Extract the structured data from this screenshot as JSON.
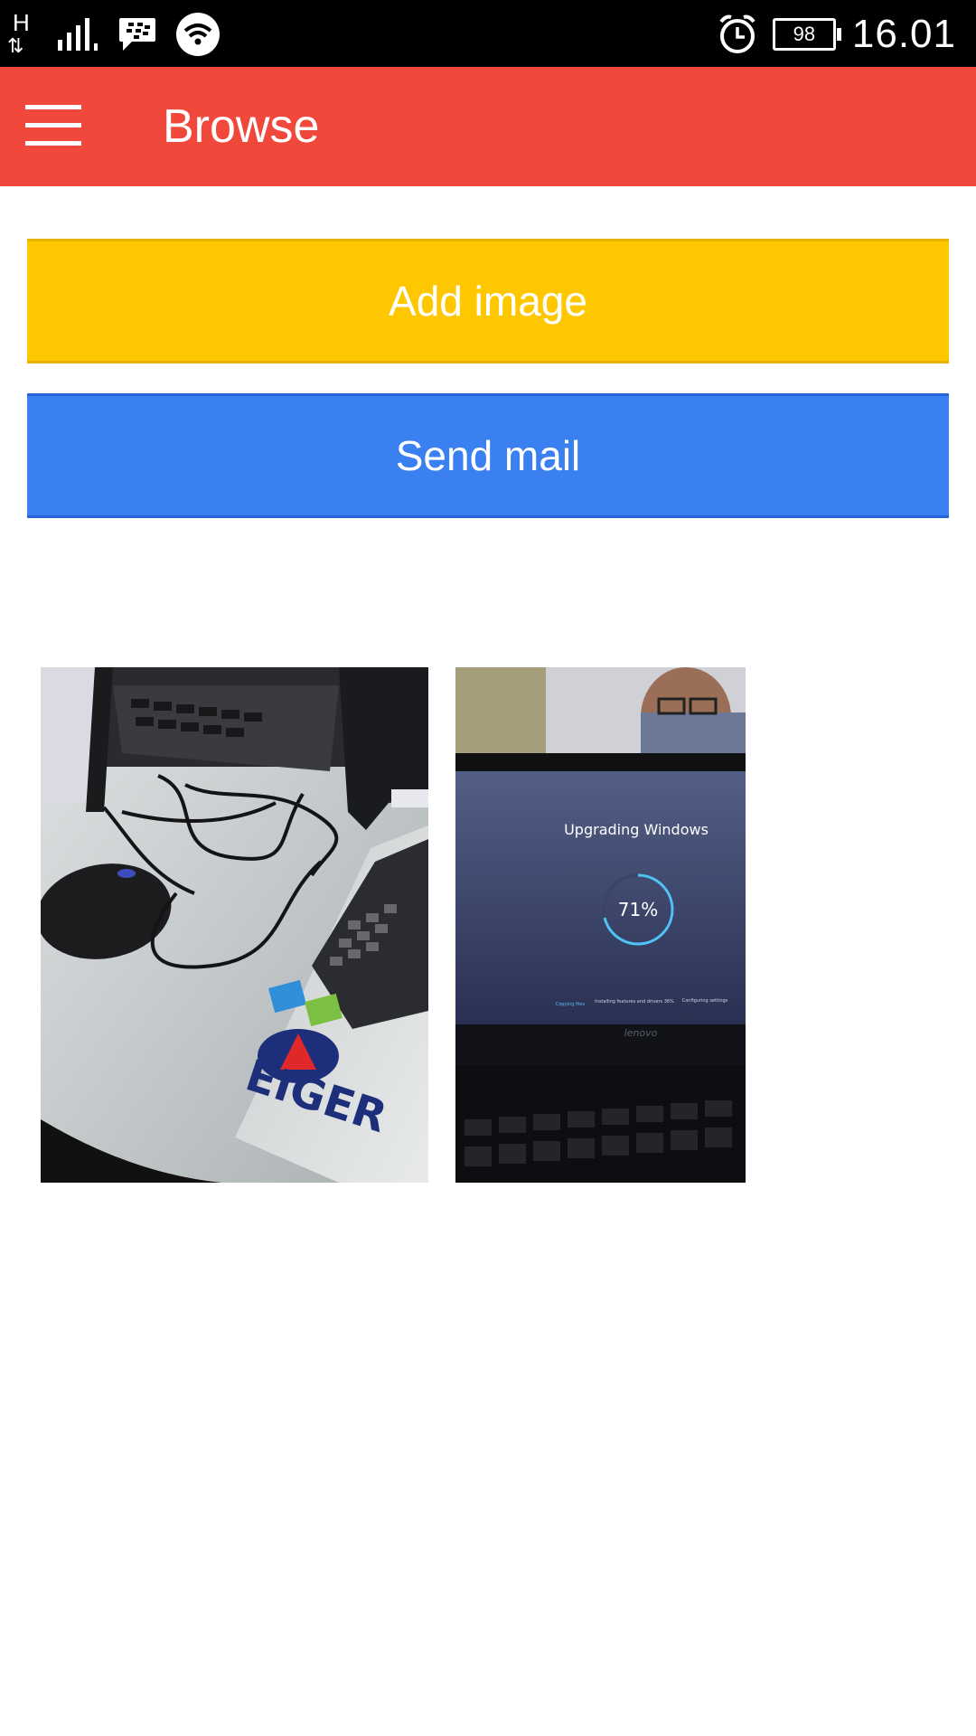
{
  "status_bar": {
    "network_type": "H",
    "network_arrows": "⇅",
    "battery_level": "98",
    "time": "16.01",
    "icons": [
      "network-type-icon",
      "signal-icon",
      "bbm-icon",
      "wifi-icon",
      "alarm-icon",
      "battery-icon"
    ]
  },
  "app_bar": {
    "title": "Browse",
    "color": "#f0483b"
  },
  "buttons": {
    "add_image": "Add image",
    "send_mail": "Send mail"
  },
  "colors": {
    "add_image_bg": "#fec700",
    "send_mail_bg": "#3b80f0"
  },
  "images": [
    {
      "name": "laptop-desk-photo",
      "sticker_text": "EIGER"
    },
    {
      "name": "windows-upgrade-photo",
      "screen_title": "Upgrading Windows",
      "progress": "71%",
      "progress_value": 0.71,
      "steps": [
        "Copying files",
        "Installing features and drivers 36%",
        "Configuring settings"
      ],
      "brand": "lenovo"
    }
  ]
}
